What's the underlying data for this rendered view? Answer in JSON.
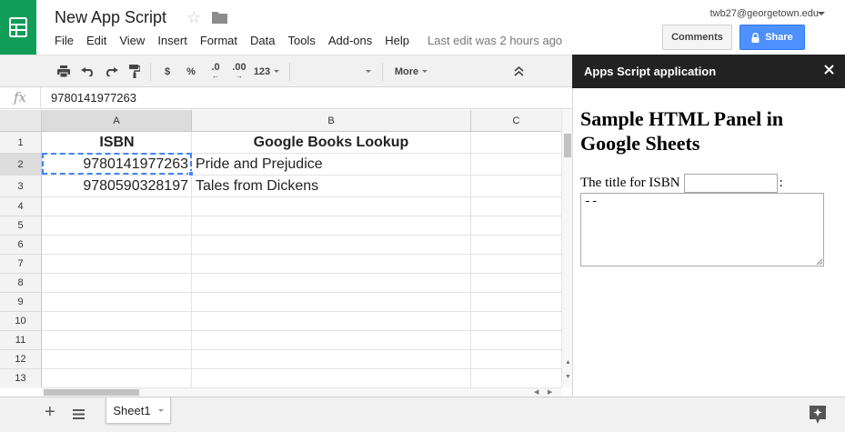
{
  "header": {
    "doc_title": "New App Script",
    "account_email": "twb27@georgetown.edu",
    "menu": [
      "File",
      "Edit",
      "View",
      "Insert",
      "Format",
      "Data",
      "Tools",
      "Add-ons",
      "Help"
    ],
    "last_edit": "Last edit was 2 hours ago",
    "comments_label": "Comments",
    "share_label": "Share",
    "brand_color": "#0f9d58",
    "share_color": "#4d90fe"
  },
  "toolbar": {
    "currency": "$",
    "percent": "%",
    "decrease_decimals": ".0",
    "increase_decimals": ".00",
    "number_format": "123",
    "more_label": "More"
  },
  "formula_bar": {
    "fx_label": "fx",
    "value": "9780141977263"
  },
  "grid": {
    "columns": [
      "A",
      "B",
      "C"
    ],
    "rows": [
      "1",
      "2",
      "3",
      "4",
      "5",
      "6",
      "7",
      "8",
      "9",
      "10",
      "11",
      "12",
      "13"
    ],
    "cells": {
      "A1": "ISBN",
      "B1": "Google Books Lookup",
      "A2": "9780141977263",
      "B2": "Pride and Prejudice",
      "A3": "9780590328197",
      "B3": "Tales from Dickens"
    },
    "selected_cell": "A2"
  },
  "sheets": {
    "tabs": [
      "Sheet1"
    ]
  },
  "panel": {
    "title": "Apps Script application",
    "heading": "Sample HTML Panel in Google Sheets",
    "prompt": "The title for ISBN",
    "prompt_suffix": ":",
    "isbn_value": "",
    "result_text": "--"
  }
}
